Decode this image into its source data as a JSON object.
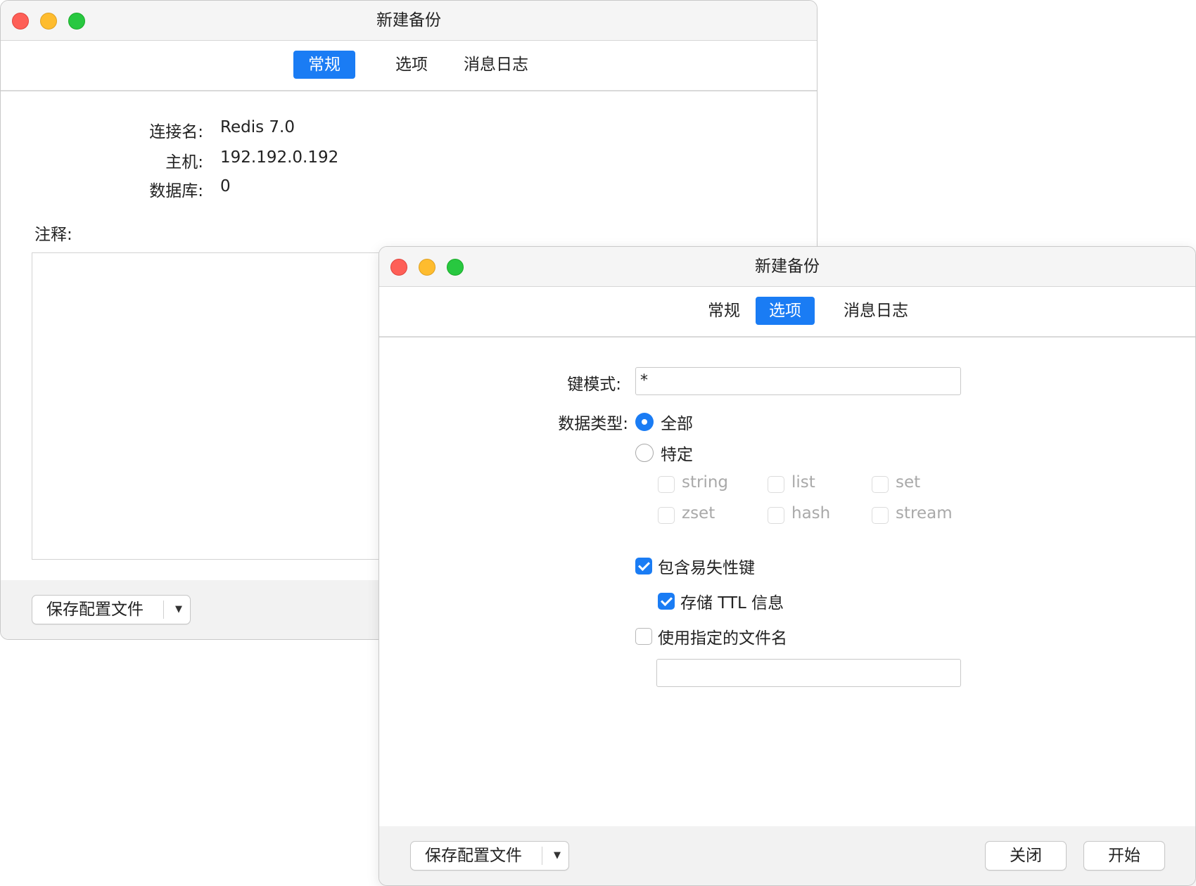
{
  "window_back": {
    "title": "新建备份",
    "tabs": [
      "常规",
      "选项",
      "消息日志"
    ],
    "info": [
      {
        "label": "连接名:",
        "value": "Redis 7.0"
      },
      {
        "label": "主机:",
        "value": "192.192.0.192"
      },
      {
        "label": "数据库:",
        "value": "0"
      }
    ],
    "notes_label": "注释:",
    "footer": {
      "save_profile_label": "保存配置文件"
    }
  },
  "window_front": {
    "title": "新建备份",
    "tabs": [
      "常规",
      "选项",
      "消息日志"
    ],
    "key_pattern": {
      "label": "键模式:",
      "value": "*"
    },
    "data_type": {
      "label": "数据类型:",
      "options": [
        "全部",
        "特定"
      ],
      "selected": "全部",
      "types": [
        {
          "name": "string",
          "checked": false,
          "enabled": false
        },
        {
          "name": "list",
          "checked": false,
          "enabled": false
        },
        {
          "name": "set",
          "checked": false,
          "enabled": false
        },
        {
          "name": "zset",
          "checked": false,
          "enabled": false
        },
        {
          "name": "hash",
          "checked": false,
          "enabled": false
        },
        {
          "name": "stream",
          "checked": false,
          "enabled": false
        }
      ]
    },
    "include_volatile": {
      "label": "包含易失性键",
      "checked": true
    },
    "store_ttl": {
      "label": "存储 TTL 信息",
      "checked": true
    },
    "use_filename": {
      "label": "使用指定的文件名",
      "checked": false,
      "value": ""
    },
    "footer": {
      "save_profile_label": "保存配置文件",
      "close_label": "关闭",
      "start_label": "开始"
    }
  },
  "colors": {
    "accent": "#1a7cf4",
    "traffic_red": "#fe5f57",
    "traffic_yellow": "#febc2e",
    "traffic_green": "#28c840"
  }
}
